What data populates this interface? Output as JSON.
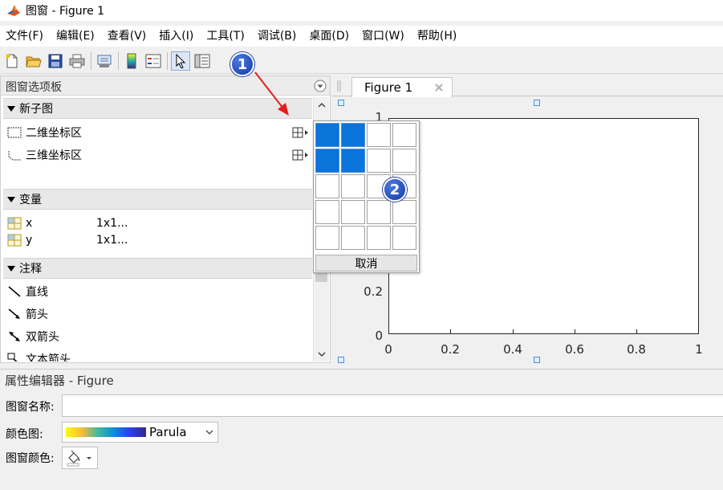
{
  "window": {
    "title": "图窗 - Figure 1",
    "app_icon": "matlab-icon"
  },
  "menu": [
    "文件(F)",
    "编辑(E)",
    "查看(V)",
    "插入(I)",
    "工具(T)",
    "调试(B)",
    "桌面(D)",
    "窗口(W)",
    "帮助(H)"
  ],
  "toolbar": {
    "icons": [
      "new-icon",
      "open-icon",
      "save-icon",
      "print-icon",
      "link-icon",
      "colorbar-icon",
      "legend-icon",
      "pointer-icon",
      "palette-toggle-icon"
    ]
  },
  "palette": {
    "title": "图窗选项板",
    "sections": {
      "subplot": {
        "label": "新子图",
        "items": [
          "二维坐标区",
          "三维坐标区"
        ]
      },
      "variables": {
        "label": "变量",
        "items": [
          {
            "name": "x",
            "value": "1x1..."
          },
          {
            "name": "y",
            "value": "1x1..."
          }
        ]
      },
      "annotations": {
        "label": "注释",
        "items": [
          "直线",
          "箭头",
          "双箭头",
          "文本箭头"
        ]
      }
    }
  },
  "grid_popup": {
    "rows": 5,
    "cols": 4,
    "selected_rows": 2,
    "selected_cols": 2,
    "cancel_label": "取消"
  },
  "figure": {
    "tab_label": "Figure 1",
    "x_ticks": [
      "0",
      "0.2",
      "0.4",
      "0.6",
      "0.8",
      "1"
    ],
    "y_ticks": [
      "0",
      "0.2",
      "1"
    ]
  },
  "annotations_callouts": [
    "1",
    "2"
  ],
  "property_editor": {
    "title": "属性编辑器 - Figure",
    "name_label": "图窗名称:",
    "name_value": "",
    "colormap_label": "颜色图:",
    "colormap_value": "Parula",
    "color_label": "图窗颜色:"
  },
  "colors": {
    "selected_cell": "#0a74da",
    "arrow": "#e02020",
    "badge": "#1a3fae"
  }
}
